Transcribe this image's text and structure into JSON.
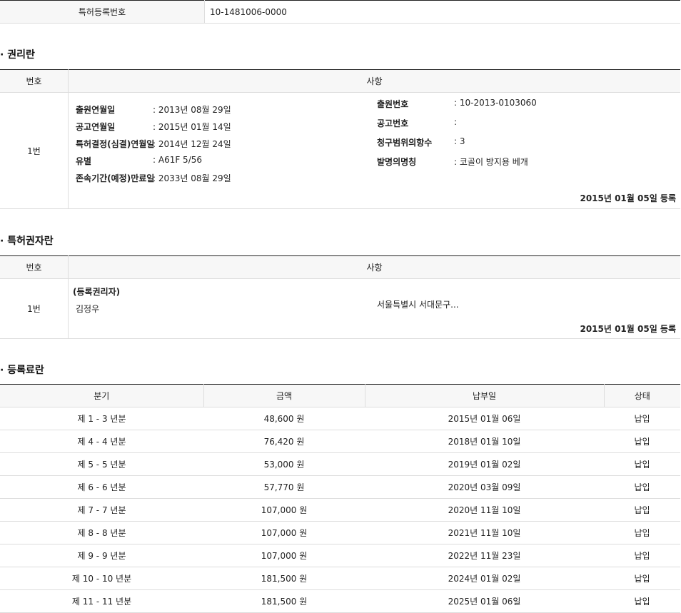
{
  "patent": {
    "label": "특허등록번호",
    "value": "10-1481006-0000"
  },
  "rights": {
    "title": "· 권리란",
    "col_no": "번호",
    "col_detail": "사항",
    "row_no": "1번",
    "left_items": [
      {
        "key": "출원연월일",
        "value": ": 2013년 08월 29일"
      },
      {
        "key": "공고연월일",
        "value": ": 2015년 01월 14일"
      },
      {
        "key": "특허결정(심결)연월일",
        "value": ": 2014년 12월 24일"
      },
      {
        "key": "유별",
        "value": ": A61F 5/56"
      },
      {
        "key": "존속기간(예정)만료일",
        "value": ": 2033년 08월 29일"
      }
    ],
    "right_items": [
      {
        "key": "출원번호",
        "value": ": 10-2013-0103060"
      },
      {
        "key": "공고번호",
        "value": ":"
      },
      {
        "key": "청구범위의항수",
        "value": ": 3"
      },
      {
        "key": "발명의명칭",
        "value": ": 코골이 방지용 베개"
      }
    ],
    "reg_date": "2015년 01월 05일 등록"
  },
  "holders": {
    "title": "· 특허권자란",
    "col_no": "번호",
    "col_detail": "사항",
    "row_no": "1번",
    "role": "(등록권리자)",
    "name": "김정우",
    "address": "서울특별시 서대문구...",
    "reg_date": "2015년 01월 05일 등록"
  },
  "fees": {
    "title": "· 등록료란",
    "headers": [
      "분기",
      "금액",
      "납부일",
      "상태"
    ],
    "rows": [
      [
        "제 1 - 3 년분",
        "48,600 원",
        "2015년 01월 06일",
        "납입"
      ],
      [
        "제 4 - 4 년분",
        "76,420 원",
        "2018년 01월 10일",
        "납입"
      ],
      [
        "제 5 - 5 년분",
        "53,000 원",
        "2019년 01월 02일",
        "납입"
      ],
      [
        "제 6 - 6 년분",
        "57,770 원",
        "2020년 03월 09일",
        "납입"
      ],
      [
        "제 7 - 7 년분",
        "107,000 원",
        "2020년 11월 10일",
        "납입"
      ],
      [
        "제 8 - 8 년분",
        "107,000 원",
        "2021년 11월 10일",
        "납입"
      ],
      [
        "제 9 - 9 년분",
        "107,000 원",
        "2022년 11월 23일",
        "납입"
      ],
      [
        "제 10 - 10 년분",
        "181,500 원",
        "2024년 01월 02일",
        "납입"
      ],
      [
        "제 11 - 11 년분",
        "181,500 원",
        "2025년 01월 06일",
        "납입"
      ]
    ]
  }
}
